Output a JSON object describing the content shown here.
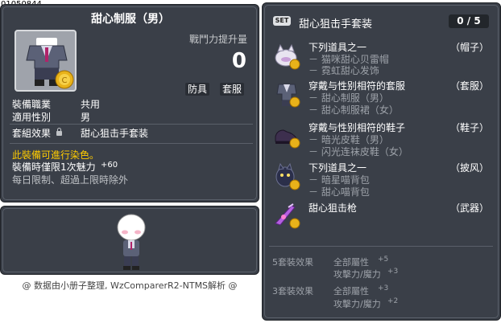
{
  "item_id": "01050844",
  "item": {
    "name": "甜心制服（男）",
    "power_label": "戰鬥力提升量",
    "power_value": "0",
    "tags": [
      "防具",
      "套服"
    ],
    "job_label": "裝備職業",
    "job_value": "共用",
    "gender_label": "適用性別",
    "gender_value": "男",
    "set_effect_label": "套組效果",
    "set_effect_value": "甜心狙击手套装",
    "dye_notice": "此裝備可進行染色。",
    "time_limit_label": "裝備時僅限1次魅力",
    "time_limit_value": "+60",
    "daily_note": "每日限制、超過上限時除外"
  },
  "credit": "@ 数据由小册子整理, WzComparerR2-NTMS解析 @",
  "set": {
    "badge": "SET",
    "name": "甜心狙击手套装",
    "count": "0 / 5",
    "items": [
      {
        "title": "下列道具之一",
        "slot": "（帽子）",
        "sub": [
          "－ 猫咪甜心贝雷帽",
          "－ 霓虹甜心发饰"
        ]
      },
      {
        "title": "穿戴与性别相符的套服",
        "slot": "（套服）",
        "sub": [
          "－ 甜心制服（男）",
          "－ 甜心制服裙（女）"
        ]
      },
      {
        "title": "穿戴与性别相符的鞋子",
        "slot": "（鞋子）",
        "sub": [
          "－ 暗光皮鞋（男）",
          "－ 闪光连袜皮鞋（女）"
        ]
      },
      {
        "title": "下列道具之一",
        "slot": "（披风）",
        "sub": [
          "－ 暗星喵背包",
          "－ 甜心喵背包"
        ]
      },
      {
        "title": "甜心狙击枪",
        "slot": "（武器）",
        "sub": []
      }
    ],
    "bonuses": [
      {
        "label": "5套裝效果",
        "lines": [
          {
            "name": "全部屬性",
            "val": "+5"
          },
          {
            "name": "攻擊力/魔力",
            "val": "+3"
          }
        ]
      },
      {
        "label": "3套裝效果",
        "lines": [
          {
            "name": "全部屬性",
            "val": "+3"
          },
          {
            "name": "攻擊力/魔力",
            "val": "+2"
          }
        ]
      }
    ]
  },
  "colors": {
    "panel": "#3a3f48",
    "dye": "#ffcc00",
    "muted": "#9da2a9"
  }
}
